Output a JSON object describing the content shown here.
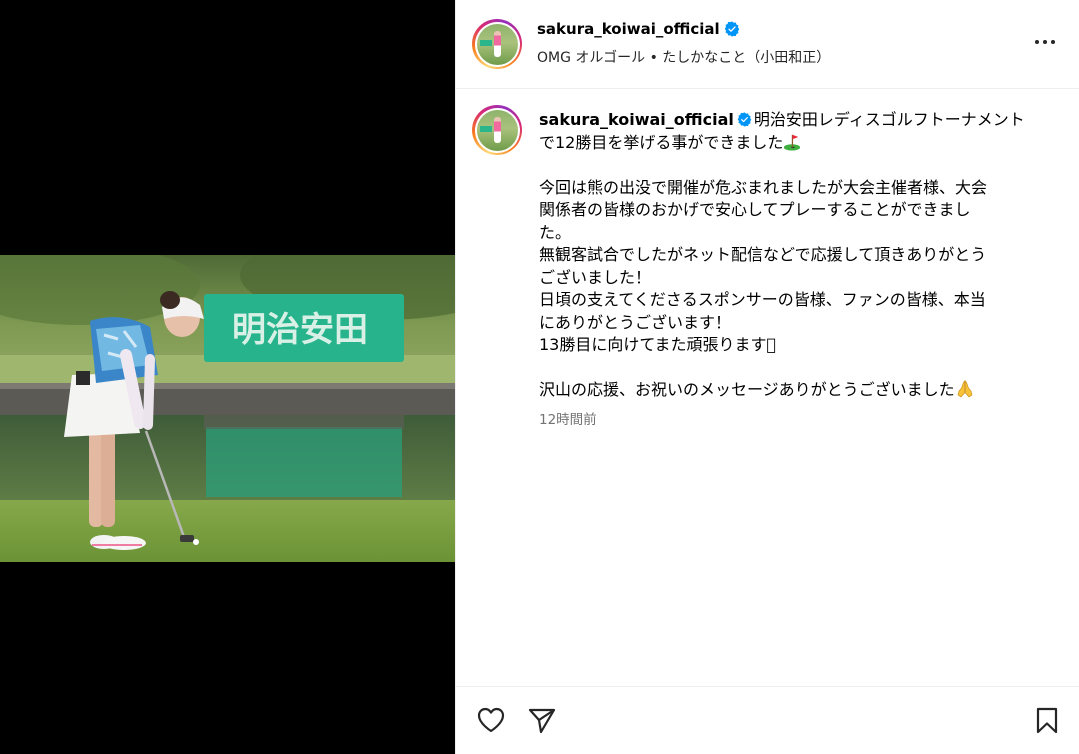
{
  "post": {
    "username": "sakura_koiwai_official",
    "audio": "OMG オルゴール • たしかなこと（小田和正）",
    "caption": {
      "username": "sakura_koiwai_official",
      "line1": "明治安田レディスゴルフトーナメント",
      "line2": "で12勝目を挙げる事ができました",
      "line3": "今回は熊の出没で開催が危ぶまれましたが大会主催者様、大会",
      "line4": "関係者の皆様のおかげで安心してプレーすることができまし",
      "line5": "た。",
      "line6": "無観客試合でしたがネット配信などで応援して頂きありがとう",
      "line7": "ございました！",
      "line8": "日頃の支えてくださるスポンサーの皆様、ファンの皆様、本当",
      "line9": "にありがとうございます！",
      "line10": "13勝目に向けてまた頑張ります􏰀",
      "line11": "沢山の応援、お祝いのメッセージありがとうございました"
    },
    "timestamp": "12時間前",
    "photo_sign_text": "明治安田"
  },
  "icons": {
    "verified": "verified-badge-icon",
    "more": "more-options-icon",
    "like": "heart-icon",
    "share": "paper-plane-icon",
    "save": "bookmark-icon",
    "golf": "golf-flag-emoji",
    "pray": "folded-hands-emoji"
  },
  "colors": {
    "verified_blue": "#0095f6",
    "timestamp_gray": "#737373",
    "divider": "#efefef"
  }
}
